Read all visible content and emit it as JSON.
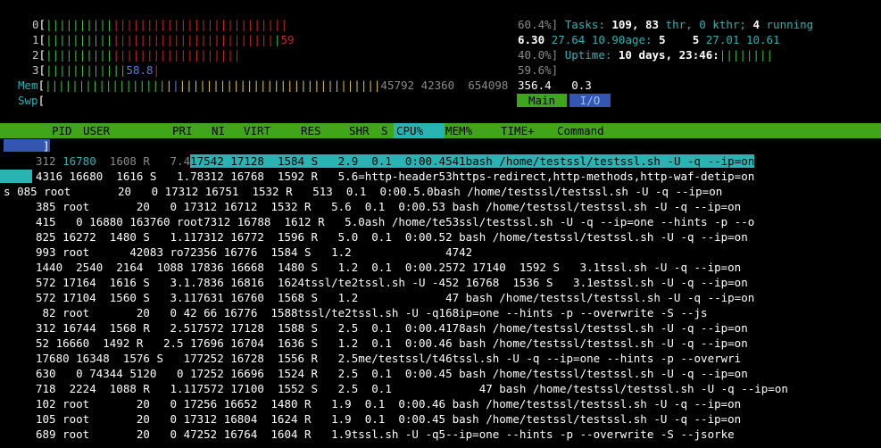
{
  "meters": {
    "cpu0": {
      "label": "0",
      "pct": "60.4%]"
    },
    "cpu1": {
      "label": "1",
      "val": "59"
    },
    "cpu2": {
      "label": "2",
      "pct": "40.0%]"
    },
    "cpu3": {
      "label": "3",
      "val": "58.8",
      "pct": "59.6%]"
    },
    "mem": {
      "label": "Mem",
      "nums": "45792 42360  654098",
      "extra": "356.4   0.3"
    },
    "swp": {
      "label": "Swp"
    }
  },
  "summary": {
    "tasks_label": "Tasks:",
    "tasks": "109,",
    "thr": "83",
    "thr_label": "thr,",
    "kthr": "0 kthr;",
    "running": "4",
    "running_label": "running",
    "load_line_a": "6.30",
    "load_line_b": "27.64",
    "load_line_c": "10.90age:",
    "load_line_d": "5",
    "load_line_e": "5",
    "load_line_f": "27.01",
    "load_line_g": "10.61",
    "uptime_label": "Uptime:",
    "uptime": "10 days, 23:46:"
  },
  "tabs": {
    "main": "Main",
    "io": "I/O"
  },
  "header": {
    "pid": "PID",
    "user": "USER",
    "pri": "PRI",
    "ni": "NI",
    "virt": "VIRT",
    "res": "RES",
    "shr": "SHR",
    "s": "S",
    "cpu": "CPU%",
    "mem": "MEM%",
    "time": "TIME+",
    "cmd": "Command"
  },
  "rows": [
    "312 16780  1608 R   7.417542 17128  1584 S   2.9  0.1  0:00.4541bash /home/testssl/testssl.sh -U -q --ip=on",
    "4316 16680  1616 S   1.78312 16768  1592 R   5.6=http-header53https-redirect,http-methods,http-waf-detip=on",
    "085 root       20   0 17312 16751  1532 R   513  0.1  0:00.5.0bash /home/testssl/testssl.sh -U -q --ip=on",
    "385 root       20   0 17312 16712  1532 R   5.6  0.1  0:00.53 bash /home/testssl/testssl.sh -U -q --ip=on",
    "415   0 16880 163760 root7312 16788  1612 R   5.0ash /home/te53ssl/testssl.sh -U -q --ip=one --hints -p --o",
    "825 16272  1480 S   1.117312 16772  1596 R   5.0  0.1  0:00.52 bash /home/testssl/testssl.sh -U -q --ip=on",
    "993 root      42083 ro72356 16776  1584 S   1.2              4742",
    "1440  2540  2164  1088 17836 16668  1480 S   1.2  0.1  0:00.2572 17140  1592 S   3.1tssl.sh -U -q --ip=on",
    "572 17164  1616 S   3.1.7836 16816  1624tssl/te2tssl.sh -U -452 16768  1536 S   3.1estssl.sh -U -q --ip=on",
    "572 17104  1560 S   3.117631 16760  1568 S   1.2             47 bash /home/testssl/testssl.sh -U -q --ip=on",
    " 82 root       20   0 42 66 16776  1588tssl/te2tssl.sh -U -q168ip=one --hints -p --overwrite -S --js",
    "312 16744  1568 R   2.517572 17128  1588 S   2.5  0.1  0:00.4178ash /home/testssl/testssl.sh -U -q --ip=on",
    "52 16660  1492 R   2.5 17696 16704  1636 S   1.2  0.1  0:00.46 bash /home/testssl/testssl.sh -U -q --ip=on",
    "17680 16348  1576 S   177252 16728  1556 R   2.5me/testssl/t46tssl.sh -U -q --ip=one --hints -p --overwri",
    "630   0 74344 5120   0 17252 16696  1524 R   2.5  0.1  0:00.45 bash /home/testssl/testssl.sh -U -q --ip=on",
    "718  2224  1088 R   1.117572 17100  1552 S   2.5  0.1             47 bash /home/testssl/testssl.sh -U -q --ip=on",
    "102 root       20   0 17256 16652  1480 R   1.9  0.1  0:00.46 bash /home/testssl/testssl.sh -U -q --ip=on",
    "105 root       20   0 17312 16804  1624 R   1.9  0.1  0:00.45 bash /home/testssl/testssl.sh -U -q --ip=on",
    "689 root       20   0 47252 16764  1604 R   1.9tssl.sh -U -q5--ip=one --hints -p --overwrite -S --jsorke"
  ],
  "colors": {
    "header_bg": "#3fa51a",
    "select_bg": "#2ab3b3",
    "tab_main": "#3fa51a",
    "tab_io": "#3456b0"
  }
}
